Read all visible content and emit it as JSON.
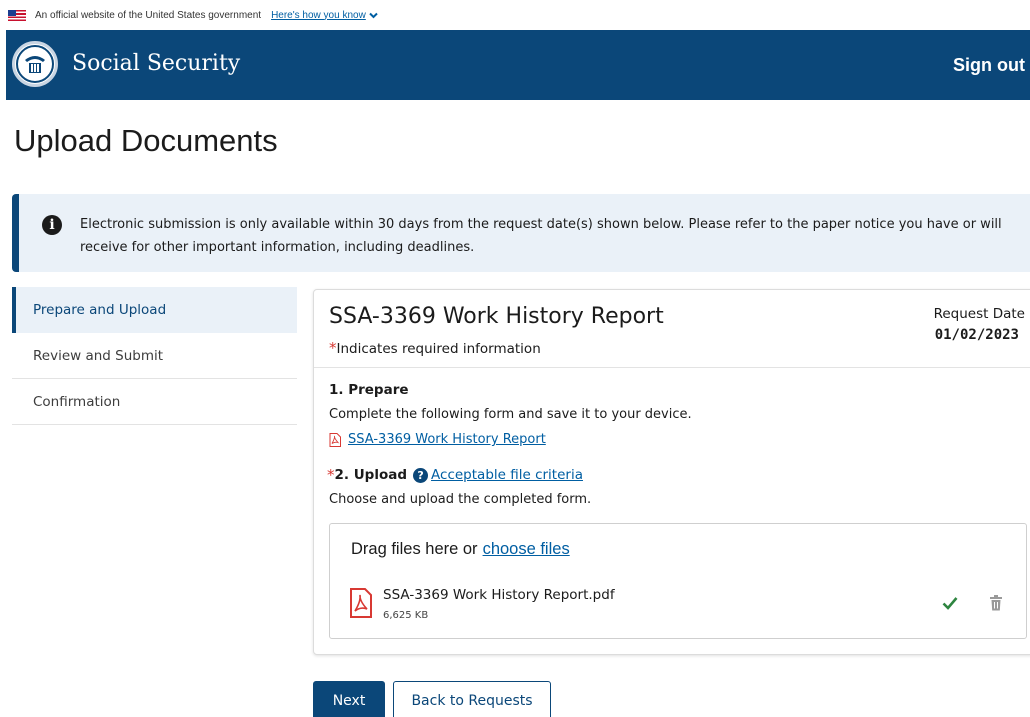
{
  "gov_banner": {
    "text": "An official website of the United States government",
    "link": "Here's how you know"
  },
  "header": {
    "brand": "Social Security",
    "sign_out": "Sign out"
  },
  "page": {
    "title": "Upload Documents"
  },
  "alert": {
    "text": "Electronic submission is only available within 30 days from the request date(s) shown below. Please refer to the paper notice you have or will receive for other important information, including deadlines."
  },
  "sidenav": {
    "items": [
      {
        "label": "Prepare and Upload",
        "active": true
      },
      {
        "label": "Review and Submit",
        "active": false
      },
      {
        "label": "Confirmation",
        "active": false
      }
    ]
  },
  "card": {
    "title": "SSA-3369 Work History Report",
    "required_asterisk": "*",
    "required_note": "Indicates required information",
    "request_date_label": "Request Date",
    "request_date": "01/02/2023",
    "prepare": {
      "heading": "1. Prepare",
      "text": "Complete the following form and save it to your device.",
      "form_link": "SSA-3369 Work History Report"
    },
    "upload": {
      "asterisk": "*",
      "heading": "2. Upload",
      "criteria_link": "Acceptable file criteria",
      "text": "Choose and upload the completed form."
    },
    "dropzone": {
      "text": "Drag files here or",
      "link": "choose files",
      "file": {
        "name": "SSA-3369 Work History Report.pdf",
        "size": "6,625 KB"
      }
    }
  },
  "buttons": {
    "next": "Next",
    "back": "Back to Requests"
  },
  "colors": {
    "header_bg": "#0b4779",
    "alert_bg": "#eaf1f8",
    "link": "#005ea2",
    "required": "#d83933",
    "success": "#2e8540"
  }
}
